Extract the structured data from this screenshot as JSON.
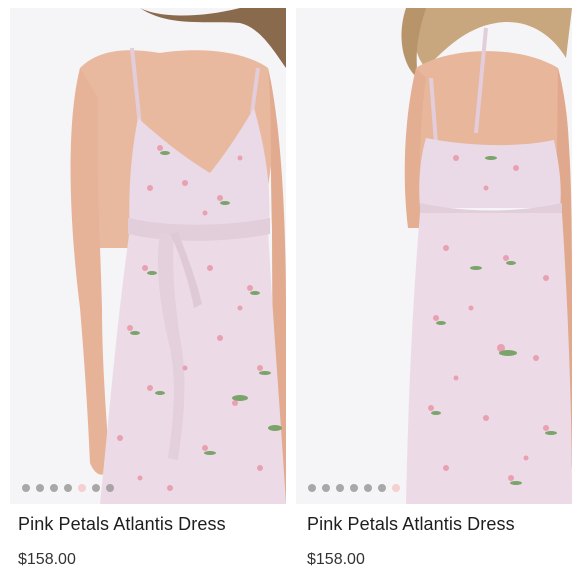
{
  "products": [
    {
      "title": "Pink Petals Atlantis Dress",
      "price": "$158.00",
      "carousel_count": 7,
      "carousel_active": 4
    },
    {
      "title": "Pink Petals Atlantis Dress",
      "price": "$158.00",
      "carousel_count": 7,
      "carousel_active": 6
    }
  ],
  "colors": {
    "dress": "#ead9e6",
    "skin": "#e8b69a",
    "petal": "#e9a0b0",
    "leaf": "#7aa46a",
    "dot_inactive": "#9a9a9a",
    "dot_active": "#f4c9c9"
  }
}
